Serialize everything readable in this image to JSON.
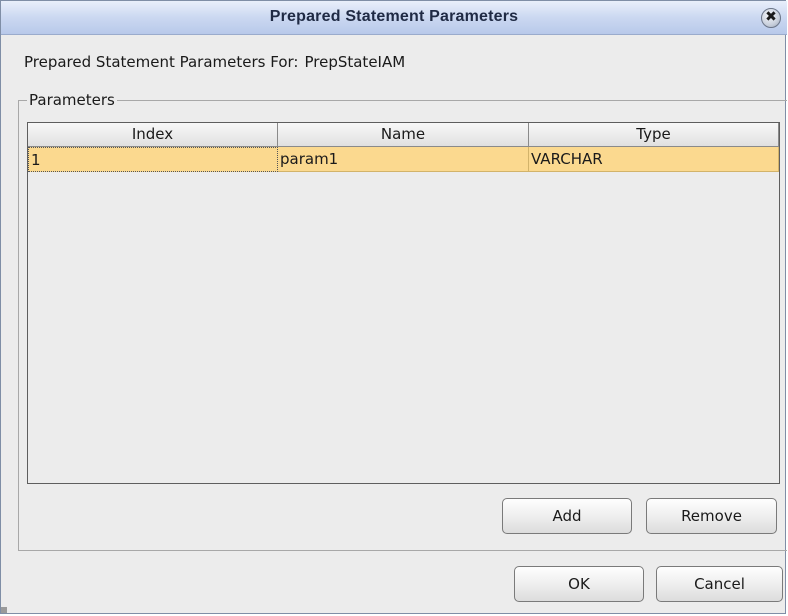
{
  "dialog": {
    "title": "Prepared Statement Parameters",
    "close_glyph": "✖"
  },
  "header": {
    "label": "Prepared Statement Parameters For:",
    "statement_name": "PrepStateIAM"
  },
  "parameters_group": {
    "legend": "Parameters"
  },
  "table": {
    "columns": [
      "Index",
      "Name",
      "Type"
    ],
    "rows": [
      {
        "index": "1",
        "name": "param1",
        "type": "VARCHAR"
      }
    ],
    "selected_row_color": "#fbd98f"
  },
  "buttons": {
    "add": "Add",
    "remove": "Remove",
    "ok": "OK",
    "cancel": "Cancel"
  },
  "colors": {
    "titlebar": "#cbd8f1",
    "dialog_bg": "#ececec"
  }
}
